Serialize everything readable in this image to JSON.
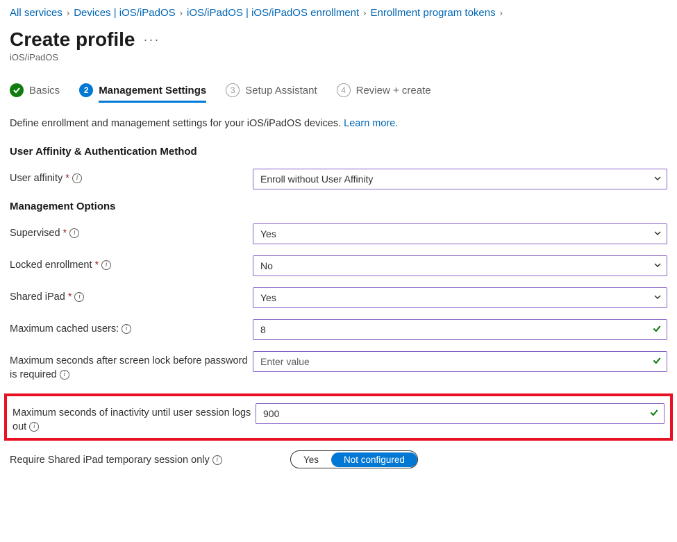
{
  "breadcrumb": {
    "items": [
      {
        "label": "All services"
      },
      {
        "label": "Devices | iOS/iPadOS"
      },
      {
        "label": "iOS/iPadOS | iOS/iPadOS enrollment"
      },
      {
        "label": "Enrollment program tokens"
      }
    ]
  },
  "header": {
    "title": "Create profile",
    "subtitle": "iOS/iPadOS"
  },
  "tabs": [
    {
      "num": "",
      "label": "Basics",
      "state": "done"
    },
    {
      "num": "2",
      "label": "Management Settings",
      "state": "active"
    },
    {
      "num": "3",
      "label": "Setup Assistant",
      "state": "pending"
    },
    {
      "num": "4",
      "label": "Review + create",
      "state": "pending"
    }
  ],
  "description": {
    "text": "Define enrollment and management settings for your iOS/iPadOS devices. ",
    "link": "Learn more."
  },
  "sections": {
    "affinity": {
      "heading": "User Affinity & Authentication Method",
      "user_affinity_label": "User affinity",
      "user_affinity_value": "Enroll without User Affinity"
    },
    "mgmt": {
      "heading": "Management Options",
      "supervised_label": "Supervised",
      "supervised_value": "Yes",
      "locked_label": "Locked enrollment",
      "locked_value": "No",
      "shared_label": "Shared iPad",
      "shared_value": "Yes",
      "max_users_label": "Maximum cached users:",
      "max_users_value": "8",
      "max_sec_lock_label": "Maximum seconds after screen lock before password is required",
      "max_sec_lock_placeholder": "Enter value",
      "max_sec_inactivity_label": "Maximum seconds of inactivity until user session logs out",
      "max_sec_inactivity_value": "900",
      "require_temp_label": "Require Shared iPad temporary session only",
      "require_temp_yes": "Yes",
      "require_temp_notconf": "Not configured"
    }
  }
}
